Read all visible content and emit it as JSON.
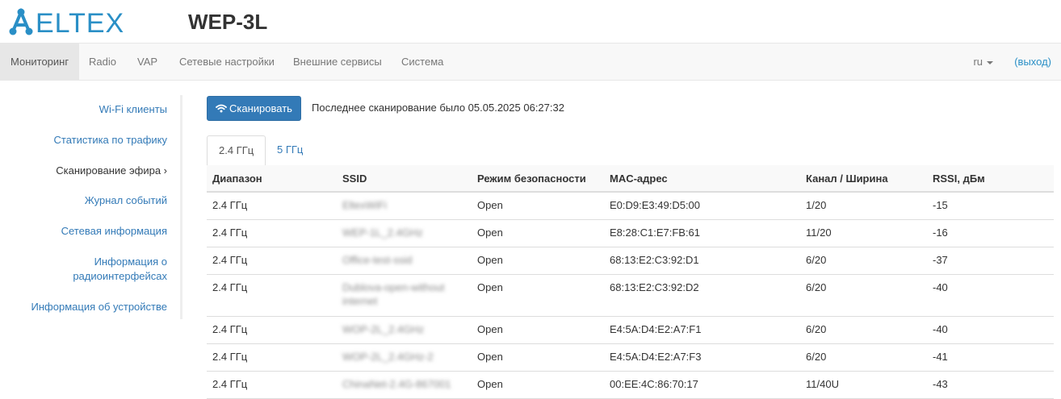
{
  "brand": {
    "logo_text": "ELTEX",
    "product": "WEP-3L",
    "logo_color": "#2a8fc6"
  },
  "navbar": {
    "items": [
      {
        "label": "Мониторинг",
        "active": true
      },
      {
        "label": "Radio",
        "active": false
      },
      {
        "label": "VAP",
        "active": false
      },
      {
        "label": "Сетевые настройки",
        "active": false
      },
      {
        "label": "Внешние сервисы",
        "active": false
      },
      {
        "label": "Система",
        "active": false
      }
    ],
    "language": "ru",
    "logout": "(выход)"
  },
  "sidebar": {
    "items": [
      {
        "label": "Wi-Fi клиенты"
      },
      {
        "label": "Статистика по трафику"
      },
      {
        "label": "Сканирование эфира ›",
        "current": true
      },
      {
        "label": "Журнал событий"
      },
      {
        "label": "Сетевая информация"
      },
      {
        "label": "Информация о радиоинтерфейсах"
      },
      {
        "label": "Информация об устройстве"
      }
    ]
  },
  "scan": {
    "button_label": "Сканировать",
    "button_icon": "wifi-icon",
    "last_scan": "Последнее сканирование было 05.05.2025 06:27:32"
  },
  "tabs": [
    {
      "label": "2.4 ГГц",
      "active": true
    },
    {
      "label": "5 ГГц",
      "active": false
    }
  ],
  "table": {
    "headers": [
      "Диапазон",
      "SSID",
      "Режим безопасности",
      "MAC-адрес",
      "Канал / Ширина",
      "RSSI, дБм"
    ],
    "rows": [
      {
        "range": "2.4 ГГц",
        "ssid": "EltexWiFi",
        "security": "Open",
        "mac": "E0:D9:E3:49:D5:00",
        "channel": "1/20",
        "rssi": "-15"
      },
      {
        "range": "2.4 ГГц",
        "ssid": "WEP-1L_2.4GHz",
        "security": "Open",
        "mac": "E8:28:C1:E7:FB:61",
        "channel": "11/20",
        "rssi": "-16"
      },
      {
        "range": "2.4 ГГц",
        "ssid": "Office-test-ssid",
        "security": "Open",
        "mac": "68:13:E2:C3:92:D1",
        "channel": "6/20",
        "rssi": "-37"
      },
      {
        "range": "2.4 ГГц",
        "ssid": "Dublova-open-without internet",
        "security": "Open",
        "mac": "68:13:E2:C3:92:D2",
        "channel": "6/20",
        "rssi": "-40"
      },
      {
        "range": "2.4 ГГц",
        "ssid": "WOP-2L_2.4GHz",
        "security": "Open",
        "mac": "E4:5A:D4:E2:A7:F1",
        "channel": "6/20",
        "rssi": "-40"
      },
      {
        "range": "2.4 ГГц",
        "ssid": "WOP-2L_2.4GHz-2",
        "security": "Open",
        "mac": "E4:5A:D4:E2:A7:F3",
        "channel": "6/20",
        "rssi": "-41"
      },
      {
        "range": "2.4 ГГц",
        "ssid": "ChinaNet-2.4G-867001",
        "security": "Open",
        "mac": "00:EE:4C:86:70:17",
        "channel": "11/40U",
        "rssi": "-43"
      }
    ]
  }
}
